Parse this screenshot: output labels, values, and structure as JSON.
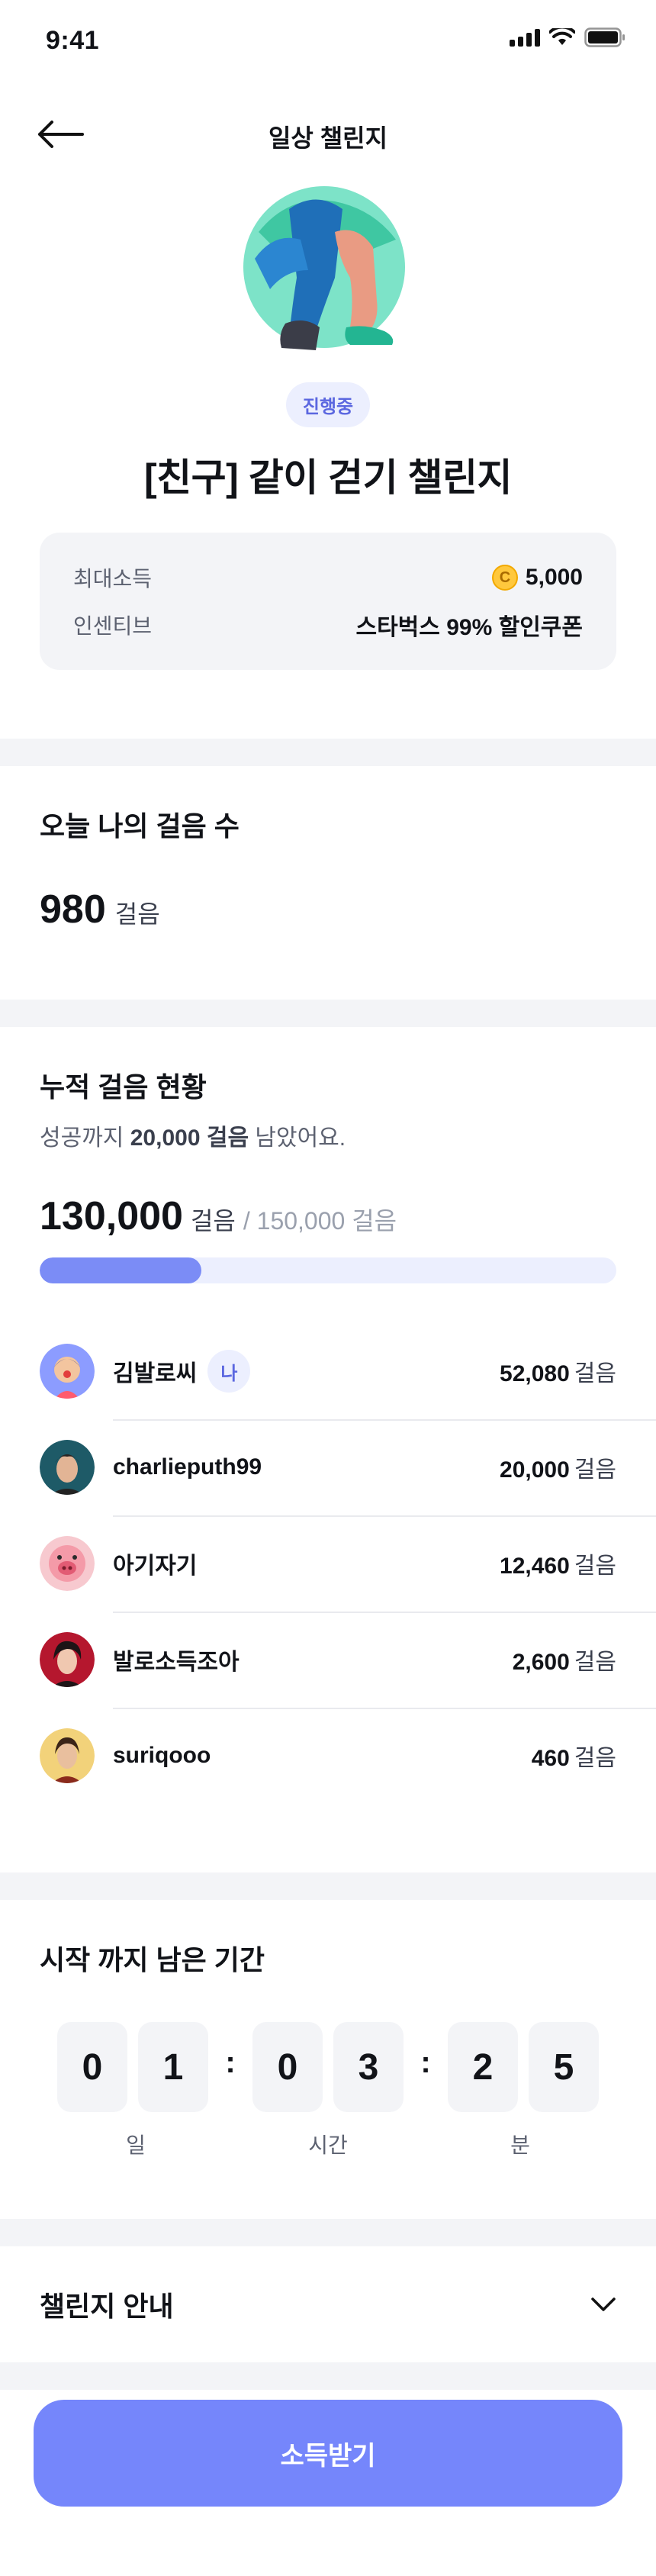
{
  "status_bar": {
    "time": "9:41"
  },
  "nav": {
    "title": "일상 챌린지"
  },
  "challenge": {
    "status_badge": "진행중",
    "title": "[친구] 같이 걷기 챌린지",
    "info": [
      {
        "label": "최대소득",
        "value": "5,000",
        "icon": "coin-icon"
      },
      {
        "label": "인센티브",
        "value": "스타벅스 99% 할인쿠폰"
      }
    ]
  },
  "today": {
    "title": "오늘 나의 걸음 수",
    "count": "980",
    "unit": "걸음"
  },
  "cumulative": {
    "title": "누적 걸음 현황",
    "remaining_prefix": "성공까지 ",
    "remaining_value": "20,000 걸음",
    "remaining_suffix": " 남았어요.",
    "current": "130,000",
    "unit": "걸음",
    "target": "/ 150,000 걸음",
    "progress_fraction": 0.28,
    "members": [
      {
        "name": "김발로씨",
        "is_me": true,
        "me_label": "나",
        "steps": "52,080",
        "unit": "걸음"
      },
      {
        "name": "charlieputh99",
        "is_me": false,
        "steps": "20,000",
        "unit": "걸음"
      },
      {
        "name": "아기자기",
        "is_me": false,
        "steps": "12,460",
        "unit": "걸음"
      },
      {
        "name": "발로소득조아",
        "is_me": false,
        "steps": "2,600",
        "unit": "걸음"
      },
      {
        "name": "suriqooo",
        "is_me": false,
        "steps": "460",
        "unit": "걸음"
      }
    ]
  },
  "countdown": {
    "title": "시작 까지 남은 기간",
    "days": [
      "0",
      "1"
    ],
    "hours": [
      "0",
      "3"
    ],
    "minutes": [
      "2",
      "5"
    ],
    "labels": [
      "일",
      "시간",
      "분"
    ]
  },
  "guide": {
    "title": "챌린지 안내"
  },
  "cta": {
    "label": "소득받기"
  },
  "colors": {
    "accent": "#7586fb",
    "badge_bg": "#eceffe",
    "badge_text": "#5b67e0",
    "coin": "#ffc83d"
  }
}
